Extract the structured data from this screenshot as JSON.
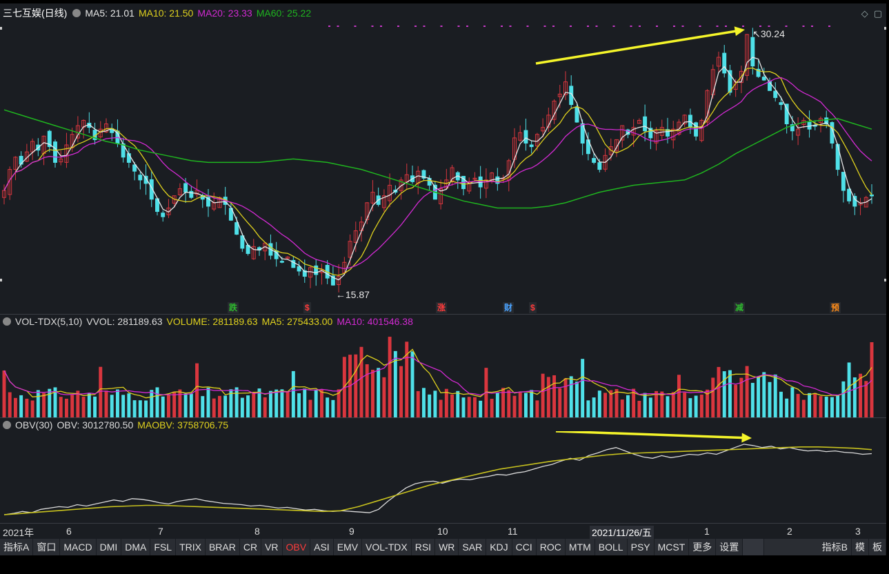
{
  "header": {
    "stock_name": "三七互娱",
    "period": "(日线)",
    "ma5": "MA5: 21.01",
    "ma10": "MA10: 21.50",
    "ma20": "MA20: 23.33",
    "ma60": "MA60: 25.22"
  },
  "price_annotations": {
    "high": "30.24",
    "low": "15.87"
  },
  "events": [
    {
      "label": "跌",
      "color": "#2eb82e"
    },
    {
      "label": "$",
      "color": "#ff3b3b"
    },
    {
      "label": "涨",
      "color": "#ff3b3b"
    },
    {
      "label": "财",
      "color": "#4aa3ff"
    },
    {
      "label": "$",
      "color": "#ff3b3b"
    },
    {
      "label": "减",
      "color": "#2eb82e"
    },
    {
      "label": "预",
      "color": "#ff8c1a"
    }
  ],
  "volume_header": {
    "name": "VOL-TDX(5,10)",
    "vvol": "VVOL: 281189.63",
    "volume": "VOLUME: 281189.63",
    "ma5": "MA5: 275433.00",
    "ma10": "MA10: 401546.38"
  },
  "obv_header": {
    "name": "OBV(30)",
    "obv": "OBV: 3012780.50",
    "maobv": "MAOBV: 3758706.75"
  },
  "dates": {
    "labels": [
      "2021年",
      "6",
      "7",
      "8",
      "9",
      "10",
      "11",
      "1",
      "2",
      "3"
    ],
    "cursor": "2021/11/26/五"
  },
  "tabs": [
    "指标A",
    "窗口",
    "MACD",
    "DMI",
    "DMA",
    "FSL",
    "TRIX",
    "BRAR",
    "CR",
    "VR",
    "OBV",
    "ASI",
    "EMV",
    "VOL-TDX",
    "RSI",
    "WR",
    "SAR",
    "KDJ",
    "CCI",
    "ROC",
    "MTM",
    "BOLL",
    "PSY",
    "MCST",
    "更多",
    "设置"
  ],
  "active_tab": "OBV",
  "right_tabs": [
    "指标B",
    "模",
    "板"
  ],
  "colors": {
    "up": "#d9363e",
    "down": "#4fe0e8",
    "ma5": "#e8e8e8",
    "ma10": "#e0d21e",
    "ma20": "#d32ad3",
    "ma60": "#1fb51f",
    "arrow": "#f5f52a",
    "obv": "#dcdcdc",
    "maobv": "#c8c21e"
  },
  "chart_data": {
    "type": "candlestick",
    "y_range": [
      15.87,
      30.24
    ],
    "closes": [
      21.3,
      22.5,
      23.2,
      22.8,
      23.5,
      24.1,
      23.6,
      24.4,
      23.8,
      22.9,
      23.1,
      23.9,
      24.5,
      25.0,
      25.3,
      24.9,
      24.2,
      24.8,
      25.1,
      24.6,
      24.0,
      23.2,
      22.9,
      22.4,
      21.9,
      21.7,
      20.8,
      20.1,
      19.8,
      20.3,
      21.0,
      21.4,
      21.2,
      20.9,
      21.3,
      20.8,
      20.4,
      20.6,
      20.9,
      20.5,
      19.6,
      18.8,
      18.0,
      17.7,
      18.1,
      17.9,
      18.3,
      17.6,
      17.4,
      17.2,
      17.5,
      16.9,
      16.7,
      16.4,
      16.9,
      16.5,
      16.8,
      16.3,
      15.9,
      16.4,
      17.2,
      18.4,
      19.0,
      19.5,
      20.6,
      21.2,
      20.5,
      21.0,
      21.6,
      21.2,
      21.9,
      22.2,
      21.8,
      22.4,
      22.0,
      21.6,
      20.8,
      21.4,
      21.9,
      22.6,
      21.9,
      21.4,
      21.8,
      22.0,
      21.5,
      21.9,
      22.3,
      21.7,
      22.0,
      23.0,
      24.3,
      24.6,
      24.0,
      23.8,
      24.5,
      24.9,
      25.6,
      26.4,
      26.8,
      27.5,
      26.2,
      25.2,
      24.0,
      23.4,
      22.9,
      22.5,
      23.3,
      23.8,
      24.2,
      25.0,
      24.5,
      24.9,
      25.3,
      24.7,
      24.3,
      24.7,
      24.9,
      24.4,
      24.8,
      25.2,
      25.6,
      24.9,
      24.4,
      25.3,
      27.0,
      28.2,
      28.9,
      28.0,
      26.9,
      27.5,
      28.1,
      30.2,
      28.4,
      27.8,
      27.6,
      27.0,
      26.6,
      26.2,
      25.1,
      24.7,
      24.8,
      25.3,
      24.8,
      25.0,
      25.4,
      25.1,
      24.0,
      22.5,
      21.3,
      20.7,
      20.4,
      20.6,
      20.9,
      21.0
    ],
    "ma60": [
      25.9,
      25.6,
      25.3,
      25.0,
      24.7,
      24.4,
      24.1,
      23.9,
      23.6,
      23.4,
      23.2,
      23.0,
      22.9,
      22.9,
      22.9,
      22.9,
      23.0,
      23.1,
      23.0,
      22.9,
      22.7,
      22.5,
      22.2,
      21.9,
      21.6,
      21.3,
      21.0,
      20.7,
      20.5,
      20.3,
      20.3,
      20.3,
      20.4,
      20.6,
      20.9,
      21.2,
      21.4,
      21.6,
      21.7,
      21.8,
      21.9,
      22.3,
      22.8,
      23.4,
      23.9,
      24.4,
      24.9,
      25.2,
      25.3,
      25.4,
      25.1,
      24.8
    ],
    "volume": {
      "vvol": 281189.63,
      "ma5": 275433.0,
      "ma10": 401546.38
    },
    "obv": [
      0.5,
      0.52,
      0.55,
      0.53,
      0.58,
      0.6,
      0.62,
      0.61,
      0.65,
      0.63,
      0.66,
      0.69,
      0.72,
      0.7,
      0.74,
      0.73,
      0.71,
      0.68,
      0.66,
      0.7,
      0.72,
      0.74,
      0.71,
      0.69,
      0.67,
      0.66,
      0.65,
      0.63,
      0.64,
      0.62,
      0.6,
      0.61,
      0.59,
      0.57,
      0.58,
      0.56,
      0.55,
      0.56,
      0.55,
      0.54,
      0.53,
      0.58,
      0.7,
      0.8,
      0.9,
      0.96,
      0.99,
      1.0,
      0.97,
      1.01,
      1.03,
      1.02,
      1.05,
      1.07,
      1.1,
      1.09,
      1.12,
      1.14,
      1.18,
      1.22,
      1.25,
      1.3,
      1.34,
      1.31,
      1.38,
      1.42,
      1.47,
      1.5,
      1.45,
      1.4,
      1.36,
      1.34,
      1.38,
      1.35,
      1.37,
      1.4,
      1.39,
      1.42,
      1.4,
      1.45,
      1.5,
      1.55,
      1.53,
      1.5,
      1.52,
      1.48,
      1.5,
      1.47,
      1.45,
      1.46,
      1.44,
      1.45,
      1.43,
      1.42,
      1.4,
      1.41
    ],
    "maobv": [
      0.5,
      0.52,
      0.54,
      0.56,
      0.58,
      0.6,
      0.62,
      0.63,
      0.64,
      0.64,
      0.63,
      0.62,
      0.61,
      0.6,
      0.59,
      0.58,
      0.57,
      0.56,
      0.55,
      0.56,
      0.62,
      0.7,
      0.78,
      0.86,
      0.94,
      1.0,
      1.06,
      1.12,
      1.18,
      1.22,
      1.26,
      1.3,
      1.33,
      1.36,
      1.39,
      1.41,
      1.42,
      1.43,
      1.44,
      1.45,
      1.46,
      1.47,
      1.48,
      1.49,
      1.5,
      1.51,
      1.51,
      1.5,
      1.49,
      1.47
    ]
  }
}
